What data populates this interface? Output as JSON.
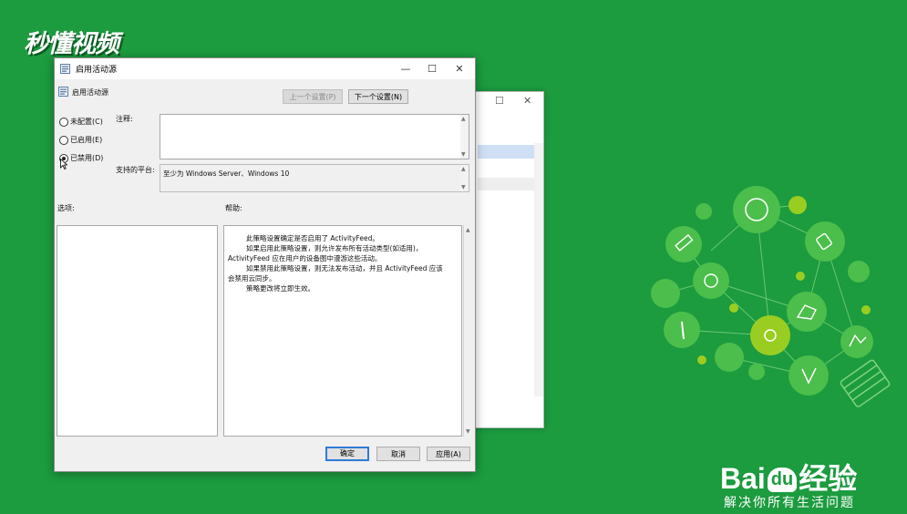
{
  "brand_logo": "秒懂视频",
  "background_window": {
    "controls": [
      "☐",
      "✕"
    ]
  },
  "dialog": {
    "title": "启用活动源",
    "window_controls": [
      "—",
      "☐",
      "✕"
    ],
    "setting_name": "启用活动源",
    "prev_button": "上一个设置(P)",
    "next_button": "下一个设置(N)",
    "radios": [
      {
        "label": "未配置(C)",
        "selected": false
      },
      {
        "label": "已启用(E)",
        "selected": false
      },
      {
        "label": "已禁用(D)",
        "selected": true
      }
    ],
    "comment_label": "注释:",
    "supported_label": "支持的平台:",
    "supported_value": "至少为 Windows Server、Windows 10",
    "options_label": "选项:",
    "help_label": "帮助:",
    "help_lines": [
      "此策略设置确定是否启用了 ActivityFeed。",
      "如果启用此策略设置，则允许发布所有活动类型(如适用)，",
      "ActivityFeed 应在用户的设备图中漫游这些活动。",
      "如果禁用此策略设置，则无法发布活动，并且 ActivityFeed 应该",
      "会禁用云同步。",
      "策略更改将立即生效。"
    ],
    "ok_button": "确定",
    "cancel_button": "取消",
    "apply_button": "应用(A)"
  },
  "watermark": {
    "brand": "Bai",
    "brand_paw": "du",
    "brand_suffix": "经验",
    "tagline": "解决你所有生活问题"
  },
  "colors": {
    "background": "#1c9b3f",
    "bubble_light": "#4cbe4b",
    "bubble_yellow": "#9acd22",
    "accent_button": "#2f7ad6"
  }
}
